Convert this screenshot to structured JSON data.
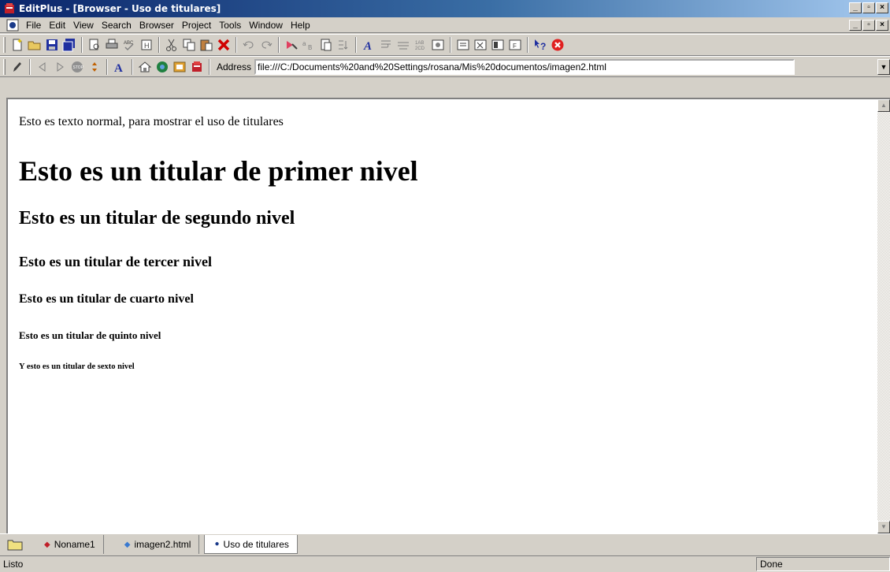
{
  "window": {
    "title": "EditPlus - [Browser - Uso de titulares]"
  },
  "menu": {
    "items": [
      {
        "label": "File",
        "key": "F"
      },
      {
        "label": "Edit",
        "key": "E"
      },
      {
        "label": "View",
        "key": "V"
      },
      {
        "label": "Search",
        "key": "S"
      },
      {
        "label": "Browser",
        "key": "B"
      },
      {
        "label": "Project",
        "key": "P"
      },
      {
        "label": "Tools",
        "key": "T"
      },
      {
        "label": "Window",
        "key": "W"
      },
      {
        "label": "Help",
        "key": "H"
      }
    ]
  },
  "browser_toolbar": {
    "address_label": "Address",
    "address_value": "file:///C:/Documents%20and%20Settings/rosana/Mis%20documentos/imagen2.html"
  },
  "page": {
    "paragraph": "Esto es texto normal, para mostrar el uso de titulares",
    "h1": "Esto es un titular de primer nivel",
    "h2": "Esto es un titular de segundo nivel",
    "h3": "Esto es un titular de tercer nivel",
    "h4": "Esto es un titular de cuarto nivel",
    "h5": "Esto es un titular de quinto nivel",
    "h6": "Y esto es un titular de sexto nivel"
  },
  "tabs": [
    {
      "label": "Noname1",
      "dot": "◆",
      "dot_color": "#c0202a"
    },
    {
      "label": "imagen2.html",
      "dot": "◆",
      "dot_color": "#3a7ad0"
    },
    {
      "label": "Uso de titulares",
      "dot": "●",
      "dot_color": "#1a3a8a",
      "active": true
    }
  ],
  "status": {
    "left": "Listo",
    "right": "Done"
  },
  "colors": {
    "titlebar_start": "#0a246a",
    "titlebar_end": "#a6caf0",
    "chrome": "#d4d0c8"
  }
}
